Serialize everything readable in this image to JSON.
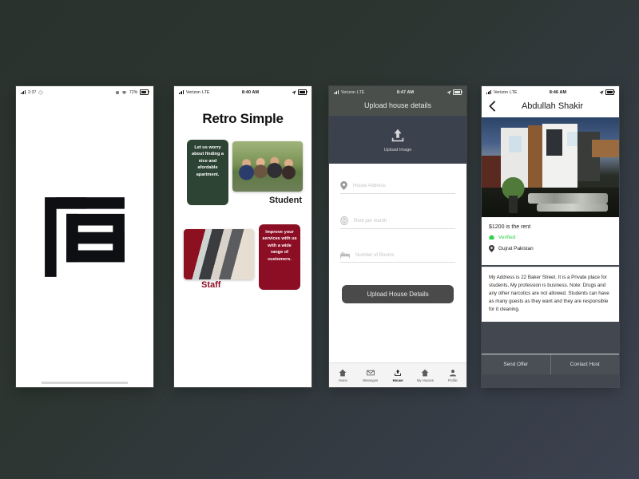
{
  "background": {
    "color_top_left": "#2a322d",
    "color_bottom_right": "#3d4250"
  },
  "phones": {
    "splash": {
      "name": "splash-screen",
      "status": {
        "carrier": "",
        "time": "2:37",
        "battery": "72%",
        "signal_icon": "signal-bars-icon",
        "battery_icon": "battery-icon",
        "wifi_icon": "wifi-icon",
        "alarm_icon": "alarm-icon"
      },
      "logo": {
        "name": "retro-simple-monogram",
        "letters": "RS",
        "color": "#0d0f12"
      }
    },
    "home": {
      "name": "retro-simple-home",
      "status": {
        "carrier": "Verizon",
        "network": "LTE",
        "time": "8:40 AM",
        "battery_icon": "battery-icon",
        "location_icon": "location-arrow-icon"
      },
      "title": "Retro Simple",
      "cards": [
        {
          "role": "Student",
          "blurb": "Let us worry about finding a nice and afordable apartment.",
          "blurb_color": "#2d4434",
          "label_color": "#1c1c1c",
          "photo_name": "students-group-photo"
        },
        {
          "role": "Staff",
          "blurb": "Improve your services with us with a wide range of customers.",
          "blurb_color": "#8c0e24",
          "label_color": "#8c0e24",
          "photo_name": "staff-handshake-photo"
        }
      ]
    },
    "upload": {
      "name": "upload-house-details",
      "status": {
        "carrier": "Verizon",
        "network": "LTE",
        "time": "8:47 AM"
      },
      "header_title": "Upload house details",
      "upload": {
        "caption": "Upload Image",
        "icon": "upload-arrow-icon"
      },
      "fields": [
        {
          "placeholder": "House Address",
          "icon": "location-pin-icon"
        },
        {
          "placeholder": "Rent per month",
          "icon": "dollar-coin-icon"
        },
        {
          "placeholder": "Number of Rooms",
          "icon": "bed-icon"
        }
      ],
      "submit_label": "Upload House Details",
      "tabs": [
        {
          "label": "Home",
          "icon": "home-icon",
          "active": false
        },
        {
          "label": "Messages",
          "icon": "envelope-icon",
          "active": false
        },
        {
          "label": "House",
          "icon": "upload-house-icon",
          "active": true
        },
        {
          "label": "My Houses",
          "icon": "home-icon",
          "active": false
        },
        {
          "label": "Profile",
          "icon": "person-icon",
          "active": false
        }
      ]
    },
    "detail": {
      "name": "house-detail",
      "status": {
        "carrier": "Verizon",
        "network": "LTE",
        "time": "8:46 AM"
      },
      "back_icon": "back-chevron-icon",
      "host_name": "Abdullah Shakir",
      "photo_name": "modern-house-photo",
      "rent": "$1200 is the rent",
      "verified": {
        "label": "Verified",
        "icon": "verified-badge-icon",
        "color": "#2fd04e"
      },
      "location": {
        "label": "Gujrat Pakistan",
        "icon": "location-pin-icon"
      },
      "description": "My Address is 22 Baker Street. It is a Private place for students, My profession is business. Note: Drugs and any other narcotics are not allowed. Students can have as many guests as they want and they are responsible for it cleaning.",
      "actions": [
        {
          "label": "Send Offer"
        },
        {
          "label": "Contact Host"
        }
      ]
    }
  }
}
